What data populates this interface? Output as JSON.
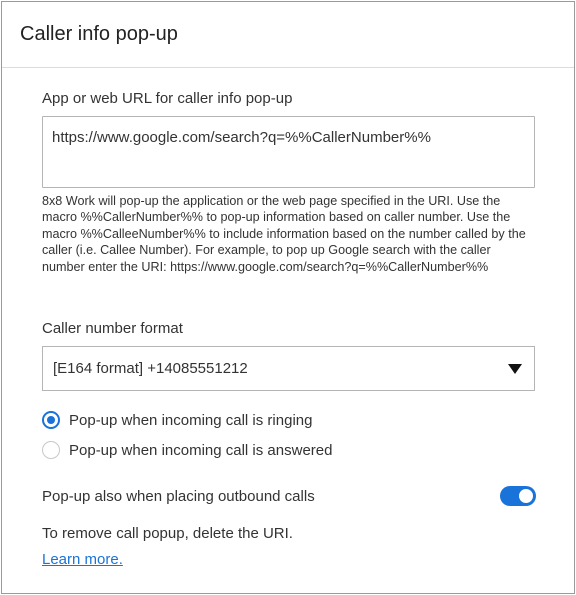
{
  "dialog": {
    "title": "Caller info pop-up"
  },
  "url_section": {
    "label": "App or web URL for caller info pop-up",
    "value": "https://www.google.com/search?q=%%CallerNumber%%",
    "help_text": "8x8 Work will pop-up the application or the web page specified in the URI. Use the macro %%CallerNumber%% to pop-up information based on caller number. Use the macro %%CalleeNumber%% to include information based on the number called by the caller (i.e. Callee Number). For example, to pop up Google search with the caller number enter the URI: https://www.google.com/search?q=%%CallerNumber%%"
  },
  "format_section": {
    "label": "Caller number format",
    "selected": "[E164 format] +14085551212"
  },
  "popup_options": [
    {
      "label": "Pop-up when incoming call is ringing",
      "checked": true
    },
    {
      "label": "Pop-up when incoming call is answered",
      "checked": false
    }
  ],
  "outbound": {
    "label": "Pop-up also when placing outbound calls",
    "enabled": true
  },
  "footer": {
    "remove_text": "To remove call popup, delete the URI.",
    "learn_more": "Learn more."
  },
  "colors": {
    "accent": "#1a73d9",
    "border": "#b5b5b5"
  }
}
